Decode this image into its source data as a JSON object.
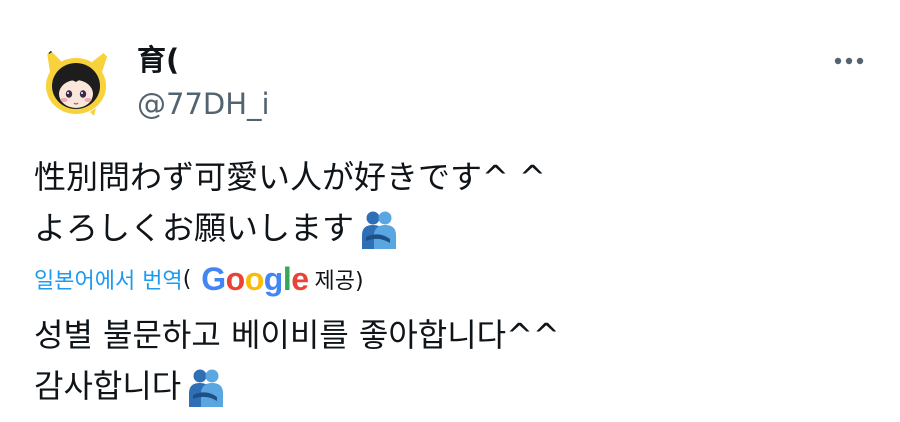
{
  "user": {
    "display_name": "育(",
    "handle": "@77DH_i",
    "avatar_icon": "pikachu-hood-avatar-icon"
  },
  "header": {
    "more_icon": "more-horizontal-icon"
  },
  "tweet": {
    "lines": [
      {
        "text": "性別問わず可愛い人が好きです^ ^",
        "emoji": ""
      },
      {
        "text": "よろしくお願いします",
        "emoji": "people-hugging"
      }
    ]
  },
  "translation": {
    "link_label": "일본어에서 번역",
    "open_paren": "(",
    "provider_logo": "Google",
    "provider_suffix": "제공)",
    "lines": [
      {
        "text": "성별 불문하고 베이비를 좋아합니다^^",
        "emoji": ""
      },
      {
        "text": "감사합니다",
        "emoji": "people-hugging"
      }
    ]
  },
  "colors": {
    "text_primary": "#0f1419",
    "text_secondary": "#536471",
    "link": "#1d9bf0",
    "google_blue": "#4285f4",
    "google_red": "#ea4335",
    "google_yellow": "#fbbc05",
    "google_green": "#34a853"
  }
}
